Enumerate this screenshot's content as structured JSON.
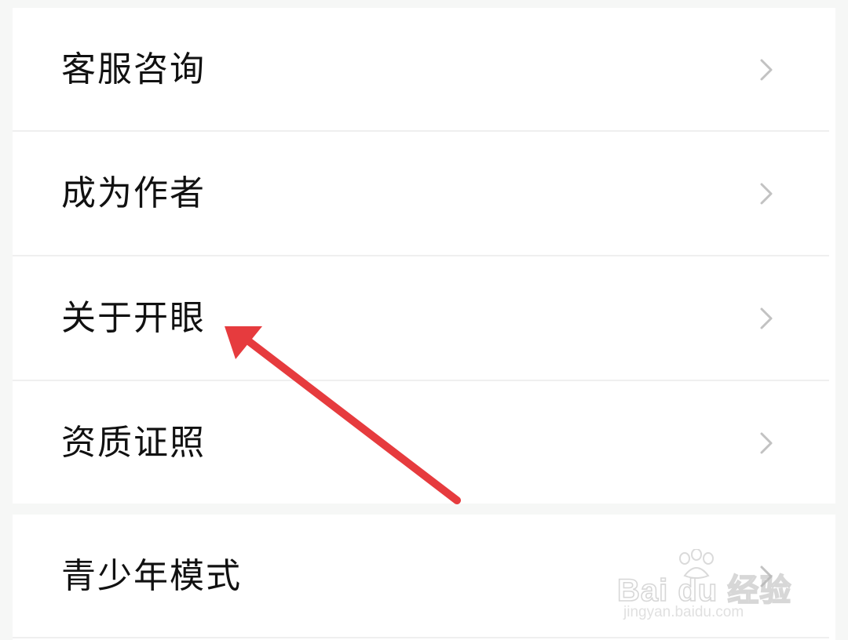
{
  "menu": {
    "items": [
      {
        "label": "客服咨询"
      },
      {
        "label": "成为作者"
      },
      {
        "label": "关于开眼"
      },
      {
        "label": "资质证照"
      },
      {
        "label": "青少年模式"
      }
    ]
  },
  "annotation": {
    "arrow_color": "#e63b3e"
  },
  "watermark": {
    "line1": "Bai du 经验",
    "line2": "jingyan.baidu.com"
  },
  "icons": {
    "chevron": "chevron-right-icon",
    "watermark_paw": "baidu-paw-icon"
  }
}
